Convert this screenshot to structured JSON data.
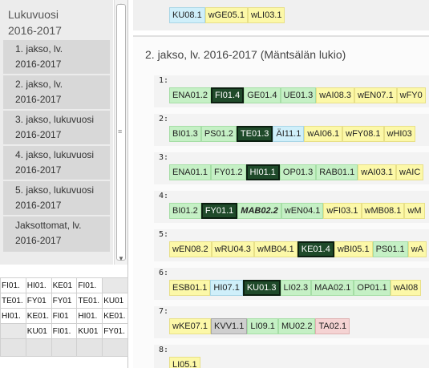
{
  "sidebar": {
    "year_label": "Lukuvuosi",
    "year_value": "2016-2017",
    "periods": [
      {
        "line1": "1. jakso, lv.",
        "line2": "2016-2017"
      },
      {
        "line1": "2. jakso, lv.",
        "line2": "2016-2017"
      },
      {
        "line1": "3. jakso, lukuvuosi",
        "line2": "2016-2017"
      },
      {
        "line1": "4. jakso, lukuvuosi",
        "line2": "2016-2017"
      },
      {
        "line1": "5. jakso, lukuvuosi",
        "line2": "2016-2017"
      },
      {
        "line1": "Jaksottomat, lv.",
        "line2": "2016-2017"
      }
    ],
    "grip": "≡"
  },
  "mini_grid": [
    [
      "FI01.",
      "HI01.",
      "KE01",
      "FI01.",
      ""
    ],
    [
      "TE01.",
      "FY01",
      "FY01",
      "TE01.",
      "KU01"
    ],
    [
      "HI01.",
      "KE01.",
      "FI01",
      "HI01.",
      "KE01."
    ],
    [
      "",
      "KU01",
      "FI01.",
      "KU01",
      "FY01."
    ]
  ],
  "top_strip": [
    "KU08.1",
    "wGE05.1",
    "wLI03.1"
  ],
  "section_title": "2. jakso, lv. 2016-2017 (Mäntsälän lukio)",
  "rows": [
    {
      "num": "1:",
      "courses": [
        {
          "code": "ENA01.2",
          "kind": "green"
        },
        {
          "code": "FI01.4",
          "kind": "dark"
        },
        {
          "code": "GE01.4",
          "kind": "green"
        },
        {
          "code": "UE01.3",
          "kind": "green"
        },
        {
          "code": "wAI08.3",
          "kind": "yellow"
        },
        {
          "code": "wEN07.1",
          "kind": "yellow"
        },
        {
          "code": "wFY0",
          "kind": "yellow"
        }
      ]
    },
    {
      "num": "2:",
      "courses": [
        {
          "code": "BI01.3",
          "kind": "green"
        },
        {
          "code": "PS01.2",
          "kind": "green"
        },
        {
          "code": "TE01.3",
          "kind": "dark"
        },
        {
          "code": "ÄI11.1",
          "kind": "blue"
        },
        {
          "code": "wAI06.1",
          "kind": "yellow"
        },
        {
          "code": "wFY08.1",
          "kind": "yellow"
        },
        {
          "code": "wHI03",
          "kind": "yellow"
        }
      ]
    },
    {
      "num": "3:",
      "courses": [
        {
          "code": "ENA01.1",
          "kind": "green"
        },
        {
          "code": "FY01.2",
          "kind": "green"
        },
        {
          "code": "HI01.1",
          "kind": "dark"
        },
        {
          "code": "OP01.3",
          "kind": "green"
        },
        {
          "code": "RAB01.1",
          "kind": "green"
        },
        {
          "code": "wAI03.1",
          "kind": "yellow"
        },
        {
          "code": "wAIC",
          "kind": "yellow"
        }
      ]
    },
    {
      "num": "4:",
      "courses": [
        {
          "code": "BI01.2",
          "kind": "green"
        },
        {
          "code": "FY01.1",
          "kind": "dark"
        },
        {
          "code": "MAB02.2",
          "kind": "bold"
        },
        {
          "code": "wEN04.1",
          "kind": "green"
        },
        {
          "code": "wFI03.1",
          "kind": "yellow"
        },
        {
          "code": "wMB08.1",
          "kind": "yellow"
        },
        {
          "code": "wM",
          "kind": "yellow"
        }
      ]
    },
    {
      "num": "5:",
      "courses": [
        {
          "code": "wEN08.2",
          "kind": "yellow"
        },
        {
          "code": "wRU04.3",
          "kind": "yellow"
        },
        {
          "code": "wMB04.1",
          "kind": "yellow"
        },
        {
          "code": "KE01.4",
          "kind": "dark"
        },
        {
          "code": "wBI05.1",
          "kind": "yellow"
        },
        {
          "code": "PS01.1",
          "kind": "green"
        },
        {
          "code": "wA",
          "kind": "yellow"
        }
      ]
    },
    {
      "num": "6:",
      "courses": [
        {
          "code": "ESB01.1",
          "kind": "yellow"
        },
        {
          "code": "HI07.1",
          "kind": "blue"
        },
        {
          "code": "KU01.3",
          "kind": "dark"
        },
        {
          "code": "LI02.3",
          "kind": "green"
        },
        {
          "code": "MAA02.1",
          "kind": "green"
        },
        {
          "code": "OP01.1",
          "kind": "green"
        },
        {
          "code": "wAI08",
          "kind": "yellow"
        }
      ]
    },
    {
      "num": "7:",
      "courses": [
        {
          "code": "wKE07.1",
          "kind": "yellow"
        },
        {
          "code": "KVV1.1",
          "kind": "gray"
        },
        {
          "code": "LI09.1",
          "kind": "green"
        },
        {
          "code": "MU02.2",
          "kind": "green"
        },
        {
          "code": "TA02.1",
          "kind": "pink"
        }
      ]
    },
    {
      "num": "8:",
      "courses": [
        {
          "code": "LI05.1",
          "kind": "yellow"
        }
      ]
    }
  ]
}
